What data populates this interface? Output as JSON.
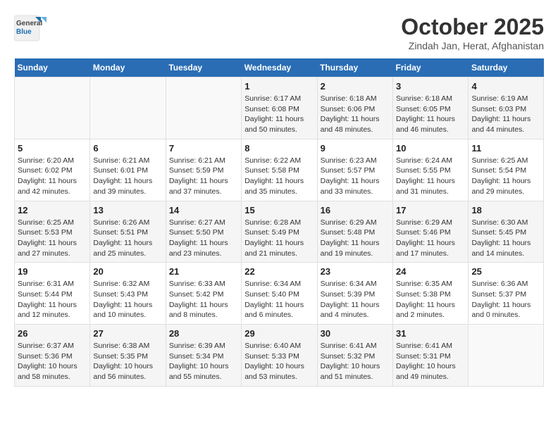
{
  "header": {
    "logo_general": "General",
    "logo_blue": "Blue",
    "month": "October 2025",
    "location": "Zindah Jan, Herat, Afghanistan"
  },
  "weekdays": [
    "Sunday",
    "Monday",
    "Tuesday",
    "Wednesday",
    "Thursday",
    "Friday",
    "Saturday"
  ],
  "weeks": [
    [
      {
        "day": "",
        "info": ""
      },
      {
        "day": "",
        "info": ""
      },
      {
        "day": "",
        "info": ""
      },
      {
        "day": "1",
        "info": "Sunrise: 6:17 AM\nSunset: 6:08 PM\nDaylight: 11 hours\nand 50 minutes."
      },
      {
        "day": "2",
        "info": "Sunrise: 6:18 AM\nSunset: 6:06 PM\nDaylight: 11 hours\nand 48 minutes."
      },
      {
        "day": "3",
        "info": "Sunrise: 6:18 AM\nSunset: 6:05 PM\nDaylight: 11 hours\nand 46 minutes."
      },
      {
        "day": "4",
        "info": "Sunrise: 6:19 AM\nSunset: 6:03 PM\nDaylight: 11 hours\nand 44 minutes."
      }
    ],
    [
      {
        "day": "5",
        "info": "Sunrise: 6:20 AM\nSunset: 6:02 PM\nDaylight: 11 hours\nand 42 minutes."
      },
      {
        "day": "6",
        "info": "Sunrise: 6:21 AM\nSunset: 6:01 PM\nDaylight: 11 hours\nand 39 minutes."
      },
      {
        "day": "7",
        "info": "Sunrise: 6:21 AM\nSunset: 5:59 PM\nDaylight: 11 hours\nand 37 minutes."
      },
      {
        "day": "8",
        "info": "Sunrise: 6:22 AM\nSunset: 5:58 PM\nDaylight: 11 hours\nand 35 minutes."
      },
      {
        "day": "9",
        "info": "Sunrise: 6:23 AM\nSunset: 5:57 PM\nDaylight: 11 hours\nand 33 minutes."
      },
      {
        "day": "10",
        "info": "Sunrise: 6:24 AM\nSunset: 5:55 PM\nDaylight: 11 hours\nand 31 minutes."
      },
      {
        "day": "11",
        "info": "Sunrise: 6:25 AM\nSunset: 5:54 PM\nDaylight: 11 hours\nand 29 minutes."
      }
    ],
    [
      {
        "day": "12",
        "info": "Sunrise: 6:25 AM\nSunset: 5:53 PM\nDaylight: 11 hours\nand 27 minutes."
      },
      {
        "day": "13",
        "info": "Sunrise: 6:26 AM\nSunset: 5:51 PM\nDaylight: 11 hours\nand 25 minutes."
      },
      {
        "day": "14",
        "info": "Sunrise: 6:27 AM\nSunset: 5:50 PM\nDaylight: 11 hours\nand 23 minutes."
      },
      {
        "day": "15",
        "info": "Sunrise: 6:28 AM\nSunset: 5:49 PM\nDaylight: 11 hours\nand 21 minutes."
      },
      {
        "day": "16",
        "info": "Sunrise: 6:29 AM\nSunset: 5:48 PM\nDaylight: 11 hours\nand 19 minutes."
      },
      {
        "day": "17",
        "info": "Sunrise: 6:29 AM\nSunset: 5:46 PM\nDaylight: 11 hours\nand 17 minutes."
      },
      {
        "day": "18",
        "info": "Sunrise: 6:30 AM\nSunset: 5:45 PM\nDaylight: 11 hours\nand 14 minutes."
      }
    ],
    [
      {
        "day": "19",
        "info": "Sunrise: 6:31 AM\nSunset: 5:44 PM\nDaylight: 11 hours\nand 12 minutes."
      },
      {
        "day": "20",
        "info": "Sunrise: 6:32 AM\nSunset: 5:43 PM\nDaylight: 11 hours\nand 10 minutes."
      },
      {
        "day": "21",
        "info": "Sunrise: 6:33 AM\nSunset: 5:42 PM\nDaylight: 11 hours\nand 8 minutes."
      },
      {
        "day": "22",
        "info": "Sunrise: 6:34 AM\nSunset: 5:40 PM\nDaylight: 11 hours\nand 6 minutes."
      },
      {
        "day": "23",
        "info": "Sunrise: 6:34 AM\nSunset: 5:39 PM\nDaylight: 11 hours\nand 4 minutes."
      },
      {
        "day": "24",
        "info": "Sunrise: 6:35 AM\nSunset: 5:38 PM\nDaylight: 11 hours\nand 2 minutes."
      },
      {
        "day": "25",
        "info": "Sunrise: 6:36 AM\nSunset: 5:37 PM\nDaylight: 11 hours\nand 0 minutes."
      }
    ],
    [
      {
        "day": "26",
        "info": "Sunrise: 6:37 AM\nSunset: 5:36 PM\nDaylight: 10 hours\nand 58 minutes."
      },
      {
        "day": "27",
        "info": "Sunrise: 6:38 AM\nSunset: 5:35 PM\nDaylight: 10 hours\nand 56 minutes."
      },
      {
        "day": "28",
        "info": "Sunrise: 6:39 AM\nSunset: 5:34 PM\nDaylight: 10 hours\nand 55 minutes."
      },
      {
        "day": "29",
        "info": "Sunrise: 6:40 AM\nSunset: 5:33 PM\nDaylight: 10 hours\nand 53 minutes."
      },
      {
        "day": "30",
        "info": "Sunrise: 6:41 AM\nSunset: 5:32 PM\nDaylight: 10 hours\nand 51 minutes."
      },
      {
        "day": "31",
        "info": "Sunrise: 6:41 AM\nSunset: 5:31 PM\nDaylight: 10 hours\nand 49 minutes."
      },
      {
        "day": "",
        "info": ""
      }
    ]
  ]
}
